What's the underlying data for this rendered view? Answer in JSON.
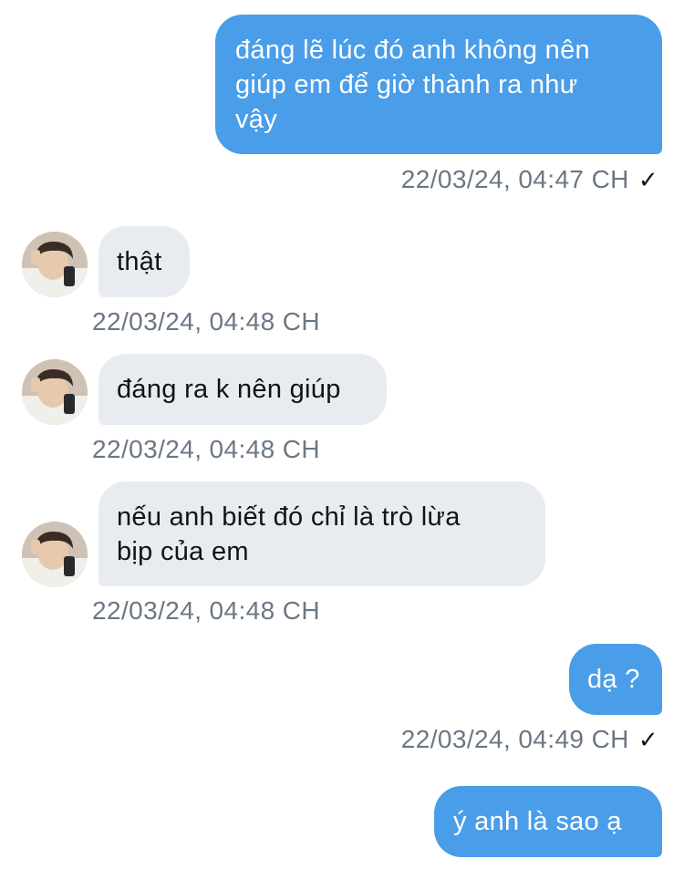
{
  "colors": {
    "outgoing_bubble": "#4a9de8",
    "incoming_bubble": "#e8ecf0",
    "timestamp": "#6b7784"
  },
  "messages": [
    {
      "direction": "out",
      "text": "đáng lẽ lúc đó anh không nên\ngiúp em để giờ thành ra như\nvậy",
      "time": "22/03/24, 04:47 CH",
      "status_icon": "check-icon",
      "status": "✓"
    },
    {
      "direction": "in",
      "text": "thật",
      "time": "22/03/24, 04:48 CH",
      "avatar": "user-avatar"
    },
    {
      "direction": "in",
      "text": "đáng ra k nên giúp",
      "time": "22/03/24, 04:48 CH",
      "avatar": "user-avatar"
    },
    {
      "direction": "in",
      "text": "nếu anh biết đó chỉ là trò lừa\nbịp của em",
      "time": "22/03/24, 04:48 CH",
      "avatar": "user-avatar"
    },
    {
      "direction": "out",
      "text": "dạ ?",
      "time": "22/03/24, 04:49 CH",
      "status_icon": "check-icon",
      "status": "✓"
    },
    {
      "direction": "out",
      "text": "ý anh là sao ạ"
    }
  ]
}
